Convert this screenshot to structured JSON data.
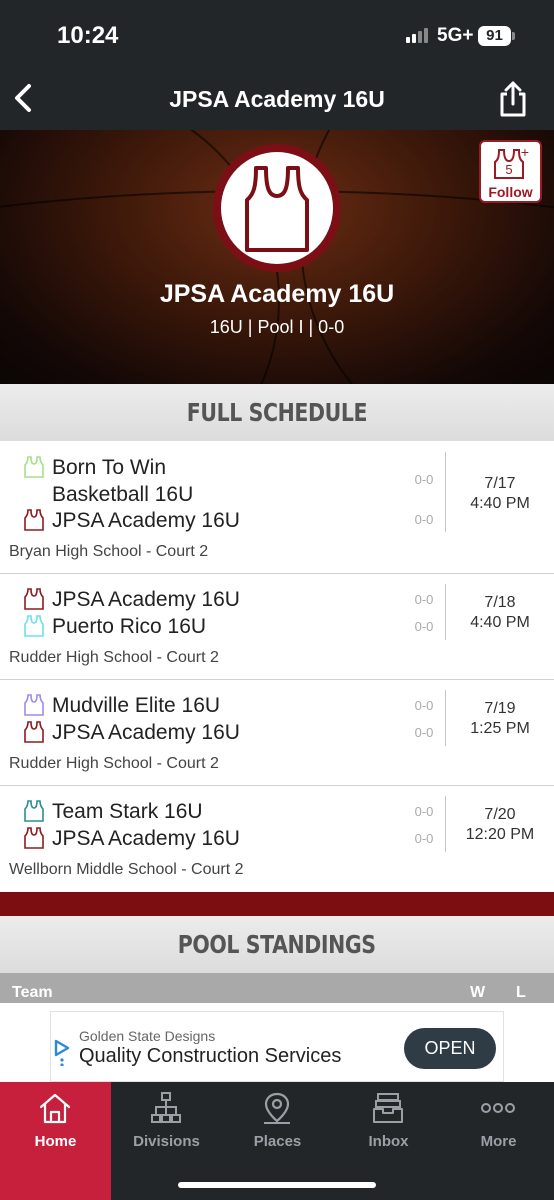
{
  "status": {
    "time": "10:24",
    "network": "5G+",
    "battery": "91"
  },
  "nav": {
    "title": "JPSA Academy 16U"
  },
  "hero": {
    "team_name": "JPSA Academy 16U",
    "meta": "16U | Pool I | 0-0",
    "follow_label": "Follow",
    "follow_badge": "5"
  },
  "colors": {
    "brand": "#7c0f16",
    "accent": "#c7203c",
    "dark": "#232629"
  },
  "schedule": {
    "heading": "FULL SCHEDULE",
    "games": [
      {
        "team1": "Born To Win Basketball 16U",
        "team1_line1": "Born To Win",
        "team1_line2": "Basketball 16U",
        "team1_color": "#a6e08a",
        "team1_score": "0-0",
        "team2": "JPSA Academy 16U",
        "team2_color": "#8b1c22",
        "team2_score": "0-0",
        "date": "7/17",
        "time": "4:40 PM",
        "venue": "Bryan High School - Court 2"
      },
      {
        "team1": "JPSA Academy 16U",
        "team1_color": "#8b1c22",
        "team1_score": "0-0",
        "team2": "Puerto Rico 16U",
        "team2_color": "#6fe0e8",
        "team2_score": "0-0",
        "date": "7/18",
        "time": "4:40 PM",
        "venue": "Rudder High School - Court 2"
      },
      {
        "team1": "Mudville Elite 16U",
        "team1_color": "#9b8cf0",
        "team1_score": "0-0",
        "team2": "JPSA Academy 16U",
        "team2_color": "#8b1c22",
        "team2_score": "0-0",
        "date": "7/19",
        "time": "1:25 PM",
        "venue": "Rudder High School - Court 2"
      },
      {
        "team1": "Team Stark 16U",
        "team1_color": "#2a8f8f",
        "team1_score": "0-0",
        "team2": "JPSA Academy 16U",
        "team2_color": "#8b1c22",
        "team2_score": "0-0",
        "date": "7/20",
        "time": "12:20 PM",
        "venue": "Wellborn Middle School - Court 2"
      }
    ]
  },
  "standings": {
    "heading": "POOL STANDINGS",
    "columns": {
      "team": "Team",
      "w": "W",
      "l": "L"
    }
  },
  "ad": {
    "advertiser": "Golden State Designs",
    "headline": "Quality Construction Services",
    "cta": "OPEN"
  },
  "tabs": [
    {
      "label": "Home",
      "icon": "home-icon",
      "active": true
    },
    {
      "label": "Divisions",
      "icon": "bracket-icon",
      "active": false
    },
    {
      "label": "Places",
      "icon": "map-pin-icon",
      "active": false
    },
    {
      "label": "Inbox",
      "icon": "inbox-icon",
      "active": false
    },
    {
      "label": "More",
      "icon": "more-dots-icon",
      "active": false
    }
  ]
}
